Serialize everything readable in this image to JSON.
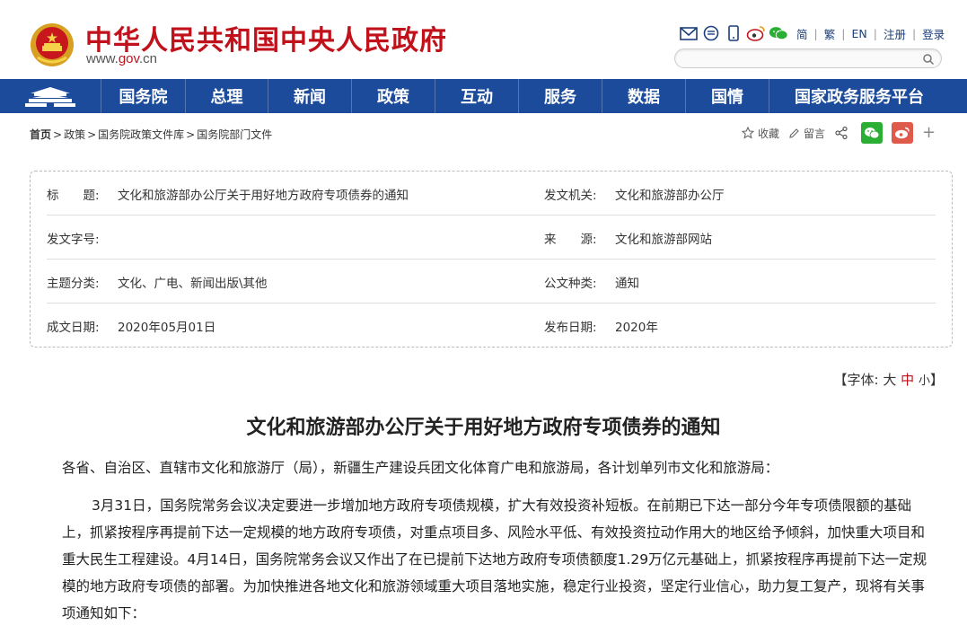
{
  "header": {
    "title": "中华人民共和国中央人民政府",
    "url_prefix": "www.",
    "url_gov": "gov",
    "url_suffix": ".cn",
    "lang_links": [
      "简",
      "繁",
      "EN",
      "注册",
      "登录"
    ],
    "search_placeholder": ""
  },
  "nav": {
    "items": [
      "国务院",
      "总理",
      "新闻",
      "政策",
      "互动",
      "服务",
      "数据",
      "国情",
      "国家政务服务平台"
    ]
  },
  "breadcrumb": {
    "home": "首页",
    "items": [
      "政策",
      "国务院政策文件库",
      "国务院部门文件"
    ],
    "sep": ">"
  },
  "share": {
    "favorite": "收藏",
    "comment": "留言"
  },
  "meta": {
    "title_label": "标　　题:",
    "title_value": "文化和旅游部办公厅关于用好地方政府专项债券的通知",
    "issuer_label": "发文机关:",
    "issuer_value": "文化和旅游部办公厅",
    "docno_label": "发文字号:",
    "docno_value": "",
    "source_label": "来　　源:",
    "source_value": "文化和旅游部网站",
    "topic_label": "主题分类:",
    "topic_value": "文化、广电、新闻出版\\其他",
    "type_label": "公文种类:",
    "type_value": "通知",
    "created_label": "成文日期:",
    "created_value": "2020年05月01日",
    "published_label": "发布日期:",
    "published_value": "2020年"
  },
  "fontsize": {
    "prefix": "【字体:",
    "large": "大",
    "medium": "中",
    "small": "小",
    "suffix": "】"
  },
  "article": {
    "title": "文化和旅游部办公厅关于用好地方政府专项债券的通知",
    "para1": "各省、自治区、直辖市文化和旅游厅（局），新疆生产建设兵团文化体育广电和旅游局，各计划单列市文化和旅游局：",
    "para2": "3月31日，国务院常务会议决定要进一步增加地方政府专项债规模，扩大有效投资补短板。在前期已下达一部分今年专项债限额的基础上，抓紧按程序再提前下达一定规模的地方政府专项债，对重点项目多、风险水平低、有效投资拉动作用大的地区给予倾斜，加快重大项目和重大民生工程建设。4月14日，国务院常务会议又作出了在已提前下达地方政府专项债额度1.29万亿元基础上，抓紧按程序再提前下达一定规模的地方政府专项债的部署。为加快推进各地文化和旅游领域重大项目落地实施，稳定行业投资，坚定行业信心，助力复工复产，现将有关事项通知如下："
  },
  "colors": {
    "brand_red": "#c1121c",
    "nav_blue": "#1b4b9a"
  }
}
